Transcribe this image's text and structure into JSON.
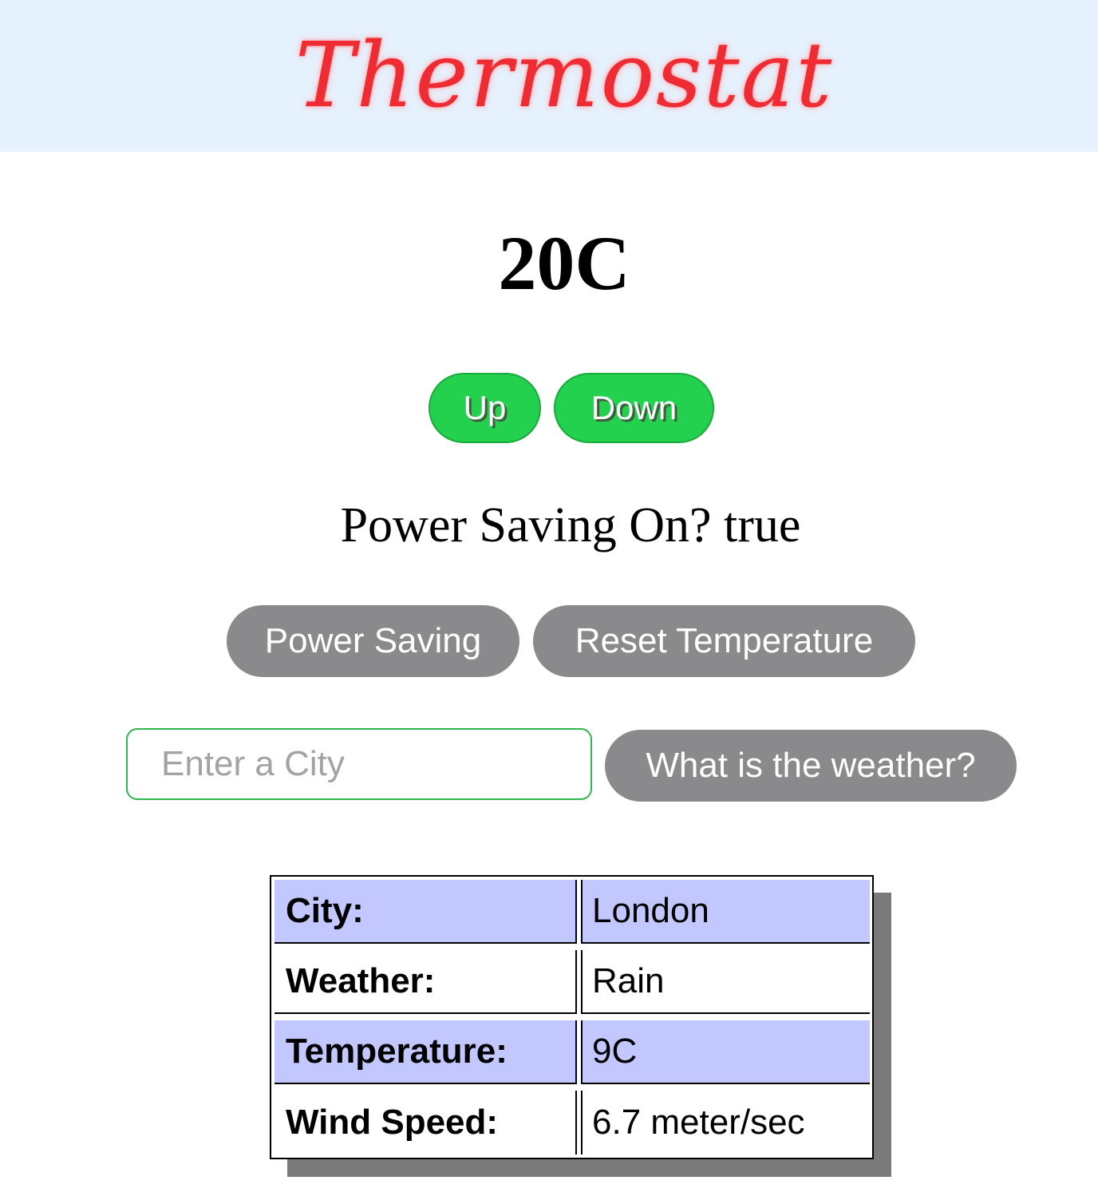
{
  "header": {
    "title": "Thermostat"
  },
  "thermostat": {
    "temperature": "20C",
    "up_label": "Up",
    "down_label": "Down",
    "power_saving_label": "Power Saving On?",
    "power_saving_value": "true",
    "power_saving_button": "Power Saving",
    "reset_button": "Reset Temperature"
  },
  "weather_form": {
    "city_placeholder": "Enter a City",
    "city_value": "",
    "submit_label": "What is the weather?"
  },
  "weather_table": {
    "rows": [
      {
        "label": "City:",
        "value": "London"
      },
      {
        "label": "Weather:",
        "value": "Rain"
      },
      {
        "label": "Temperature:",
        "value": "9C"
      },
      {
        "label": "Wind Speed:",
        "value": "6.7 meter/sec"
      }
    ]
  },
  "colors": {
    "header_bg": "#e5f1fd",
    "title": "#ef2b33",
    "green_button": "#23d14f",
    "grey_button": "#8a898c",
    "input_border": "#2fb74b",
    "table_row_shade": "#c2c7fd"
  }
}
